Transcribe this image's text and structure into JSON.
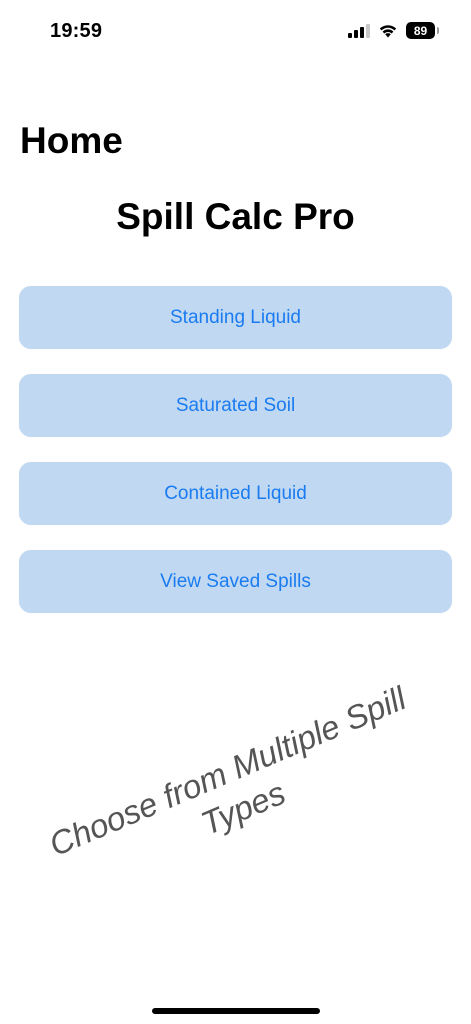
{
  "status_bar": {
    "time": "19:59",
    "battery_level": "89",
    "signal_bars_active": 3,
    "signal_bars_total": 4
  },
  "nav": {
    "title": "Home"
  },
  "app": {
    "title": "Spill Calc Pro"
  },
  "buttons": [
    {
      "label": "Standing Liquid"
    },
    {
      "label": "Saturated Soil"
    },
    {
      "label": "Contained Liquid"
    },
    {
      "label": "View Saved Spills"
    }
  ],
  "caption": {
    "text": "Choose from Multiple Spill Types"
  },
  "colors": {
    "button_bg": "#c0d8f2",
    "button_text": "#1a7cf0",
    "caption_text": "#555555"
  }
}
